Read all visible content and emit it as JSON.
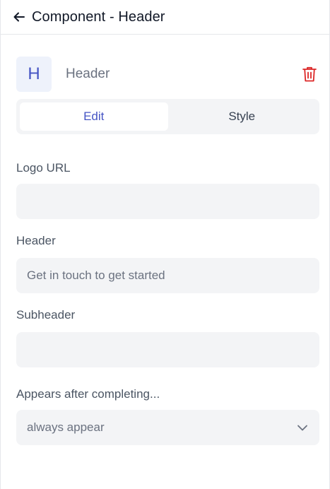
{
  "header": {
    "title": "Component - Header"
  },
  "component": {
    "avatar_letter": "H",
    "name": "Header"
  },
  "tabs": [
    {
      "label": "Edit",
      "active": true
    },
    {
      "label": "Style",
      "active": false
    }
  ],
  "fields": {
    "logo_url": {
      "label": "Logo URL",
      "value": ""
    },
    "header": {
      "label": "Header",
      "placeholder": "Get in touch to get started",
      "value": ""
    },
    "subheader": {
      "label": "Subheader",
      "value": ""
    },
    "appears_after": {
      "label": "Appears after completing...",
      "selected": "always appear"
    }
  },
  "colors": {
    "accent": "#4554c4",
    "danger": "#dc2626",
    "input_bg": "#f3f4f6"
  },
  "icons": {
    "back": "arrow-left-icon",
    "delete": "trash-icon",
    "dropdown": "chevron-down-icon"
  }
}
